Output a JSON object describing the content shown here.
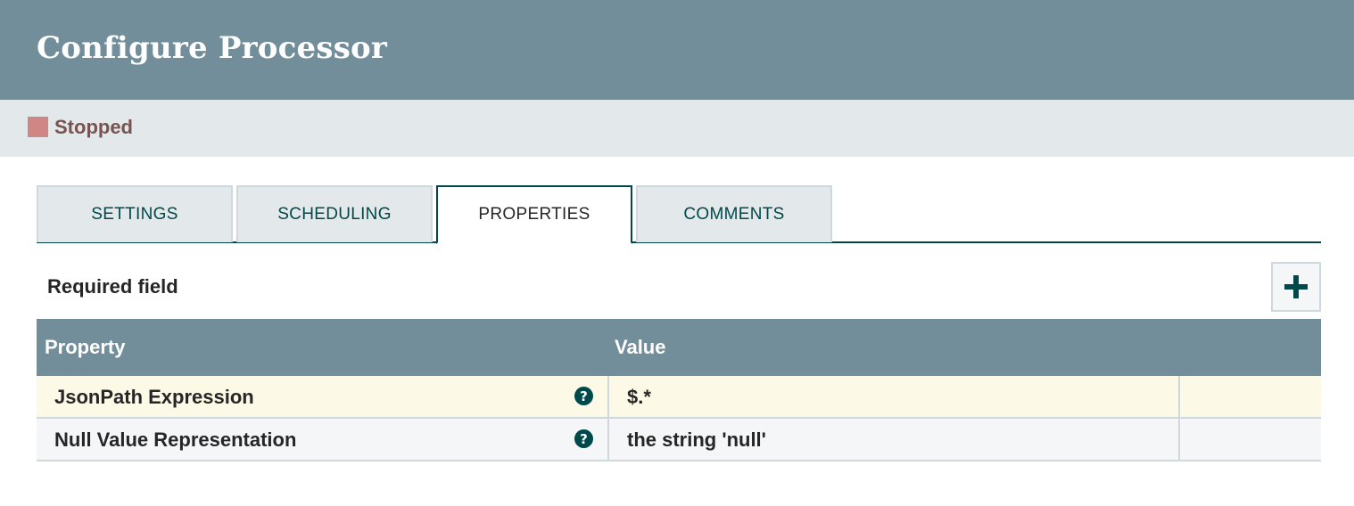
{
  "header": {
    "title": "Configure Processor"
  },
  "status": {
    "label": "Stopped",
    "color": "#d18686"
  },
  "tabs": [
    {
      "label": "SETTINGS",
      "active": false
    },
    {
      "label": "SCHEDULING",
      "active": false
    },
    {
      "label": "PROPERTIES",
      "active": true
    },
    {
      "label": "COMMENTS",
      "active": false
    }
  ],
  "properties": {
    "required_label": "Required field",
    "add_icon": "plus-icon",
    "columns": {
      "property": "Property",
      "value": "Value"
    },
    "rows": [
      {
        "name": "JsonPath Expression",
        "help_icon": "?",
        "value": "$.*"
      },
      {
        "name": "Null Value Representation",
        "help_icon": "?",
        "value": "the string 'null'"
      }
    ]
  },
  "colors": {
    "header_bg": "#728e9b",
    "accent": "#004849",
    "row_highlight": "#fdf9e7"
  }
}
